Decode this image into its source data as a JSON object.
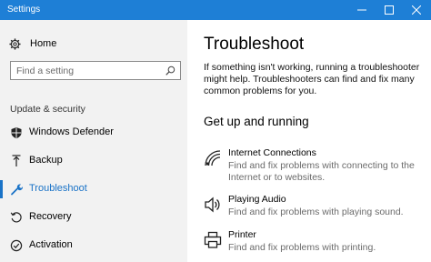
{
  "window": {
    "title": "Settings"
  },
  "sidebar": {
    "home_label": "Home",
    "search_placeholder": "Find a setting",
    "section_label": "Update & security",
    "items": [
      {
        "label": "Windows Defender",
        "icon": "shield-icon",
        "active": false
      },
      {
        "label": "Backup",
        "icon": "backup-arrow-icon",
        "active": false
      },
      {
        "label": "Troubleshoot",
        "icon": "wrench-icon",
        "active": true
      },
      {
        "label": "Recovery",
        "icon": "recovery-icon",
        "active": false
      },
      {
        "label": "Activation",
        "icon": "activation-check-icon",
        "active": false
      }
    ]
  },
  "main": {
    "title": "Troubleshoot",
    "intro": "If something isn't working, running a troubleshooter might help. Troubleshooters can find and fix many common problems for you.",
    "section_heading": "Get up and running",
    "troubleshooters": [
      {
        "name": "Internet Connections",
        "description": "Find and fix problems with connecting to the Internet or to websites.",
        "icon": "wifi-icon"
      },
      {
        "name": "Playing Audio",
        "description": "Find and fix problems with playing sound.",
        "icon": "speaker-icon"
      },
      {
        "name": "Printer",
        "description": "Find and fix problems with printing.",
        "icon": "printer-icon"
      }
    ]
  },
  "colors": {
    "titlebar": "#1e7fd6",
    "sidebar_bg": "#f2f2f2",
    "accent": "#1a73c7",
    "secondary_text": "#6b6b6b"
  }
}
